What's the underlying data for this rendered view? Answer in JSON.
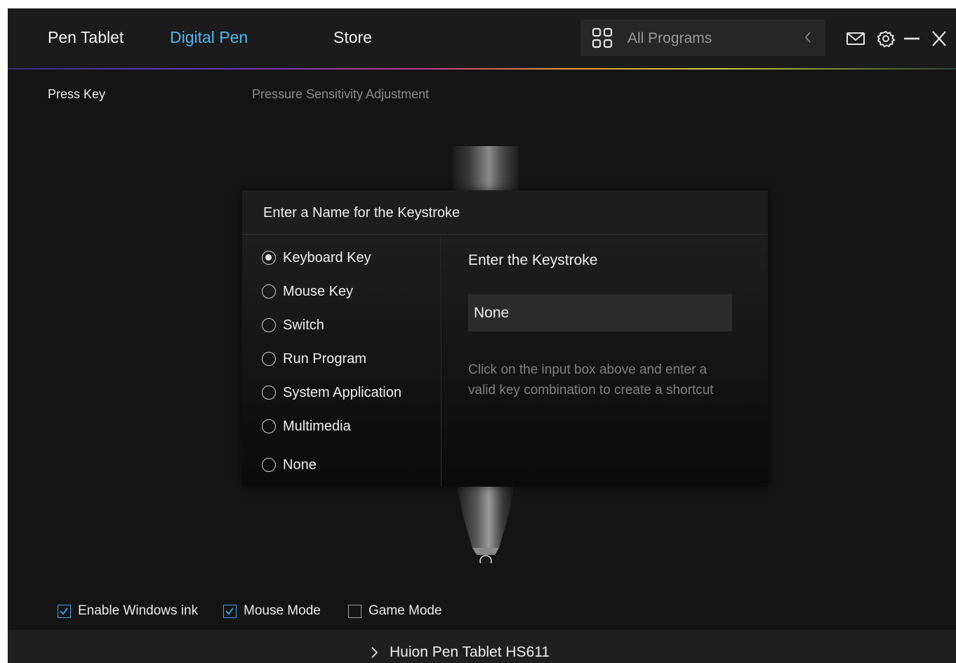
{
  "nav": {
    "tabs": [
      {
        "label": "Pen Tablet"
      },
      {
        "label": "Digital Pen"
      },
      {
        "label": "Store"
      }
    ],
    "active_tab": "Digital Pen",
    "programs_label": "All Programs",
    "icons": [
      "grid-icon",
      "chevron-left-icon",
      "mail-icon",
      "gear-icon",
      "minimize-icon",
      "close-icon"
    ]
  },
  "subtabs": {
    "press_key": "Press Key",
    "pressure": "Pressure Sensitivity Adjustment"
  },
  "dialog": {
    "title": "Enter a Name for the Keystroke",
    "options": [
      {
        "label": "Keyboard Key",
        "checked": true
      },
      {
        "label": "Mouse Key",
        "checked": false
      },
      {
        "label": "Switch",
        "checked": false
      },
      {
        "label": "Run Program",
        "checked": false
      },
      {
        "label": "System Application",
        "checked": false
      },
      {
        "label": "Multimedia",
        "checked": false
      },
      {
        "label": "None",
        "checked": false
      }
    ],
    "keystroke_title": "Enter the Keystroke",
    "keystroke_value": "None",
    "hint": "Click on the input box above and enter a valid key combination to create a shortcut"
  },
  "options": {
    "windows_ink": {
      "label": "Enable Windows ink",
      "checked": true
    },
    "mouse_mode": {
      "label": "Mouse Mode",
      "checked": true
    },
    "game_mode": {
      "label": "Game Mode",
      "checked": false
    }
  },
  "footer": {
    "device": "Huion Pen Tablet HS611"
  },
  "colors": {
    "accent": "#52b6f5",
    "background": "#141414",
    "checkbox_accent": "#3ea8f0"
  }
}
